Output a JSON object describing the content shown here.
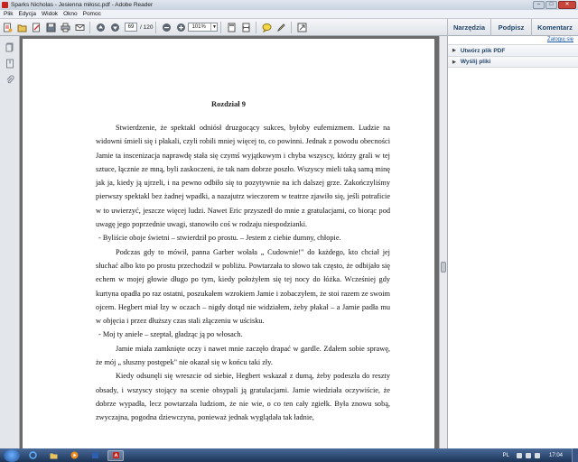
{
  "window": {
    "title": "Sparks Nicholas - Jesienna miłosc.pdf - Adobe Reader"
  },
  "menu": [
    "Plik",
    "Edycja",
    "Widok",
    "Okno",
    "Pomoc"
  ],
  "toolbar": {
    "current_page": "69",
    "total_pages": "/ 120",
    "zoom": "101%",
    "panel_buttons": [
      "Narzędzia",
      "Podpisz",
      "Komentarz"
    ]
  },
  "right_panel": {
    "login": "Zaloguj się",
    "items": [
      "Utwórz plik PDF",
      "Wyślij pliki"
    ]
  },
  "document": {
    "chapter": "Rozdział 9",
    "paragraphs": [
      "Stwierdzenie, że spektakl odniósł druzgocący sukces, byłoby eufemizmem. Ludzie na widowni śmieli się i płakali, czyli robili mniej więcej to, co powinni. Jednak z powodu obecności Jamie ta inscenizacja naprawdę stała się czymś wyjątkowym i chyba wszyscy, którzy grali w tej sztuce, łącznie ze mną, byli zaskoczeni, że tak nam dobrze poszło. Wszyscy mieli taką samą minę jak ja, kiedy ją ujrzeli, i na pewno odbiło się to pozytywnie na ich dalszej grze. Zakończyliśmy pierwszy spektakl bez żadnej wpadki, a nazajutrz wieczorem w teatrze zjawiło się, jeśli potraficie w to uwierzyć, jeszcze więcej ludzi. Nawet Eric przyszedł do mnie z gratulacjami, co biorąc pod uwagę jego poprzednie uwagi, stanowiło coś w rodzaju niespodzianki.",
      "- Byliście oboje świetni – stwierdził po prostu. – Jestem z ciebie dumny, chłopie.",
      "Podczas gdy to mówił, panna Garber wołała „ Cudownie!\" do każdego, kto chciał jej słuchać albo kto po prostu przechodził w pobliżu. Powtarzała to słowo tak często, że odbijało się echem w mojej głowie długo po tym, kiedy położyłem się tej nocy do łóżka. Wcześniej gdy kurtyna opadła po raz ostatni, poszukałem wzrokiem Jamie i zobaczyłem, że stoi razem ze swoim ojcem. Hegbert miał łzy w oczach – nigdy dotąd nie widziałem, żeby płakał – a Jamie padła mu w objęcia i przez dłuższy czas stali złączeniu w uścisku.",
      "- Moj ty aniele – szeptał, gładząc ją po włosach.",
      "Jamie miała zamknięte oczy i nawet mnie zaczęło drapać w gardle. Zdałem sobie sprawę, że mój „ słuszny postępek\" nie okazał się w końcu taki zły.",
      "Kiedy odsunęli się wreszcie od siebie, Hegbert wskazał z dumą, żeby podeszła do reszty obsady, i wszyscy stojący na scenie obsypali ją gratulacjami. Jamie wiedziała oczywiście, że dobrze wypadła, lecz powtarzała ludziom, że nie wie, o co ten cały zgiełk. Była znowu sobą, zwyczajna, pogodna dziewczyna, ponieważ jednak wyglądała tak ładnie,"
    ]
  },
  "taskbar": {
    "language": "PL",
    "clock": "17:04"
  }
}
